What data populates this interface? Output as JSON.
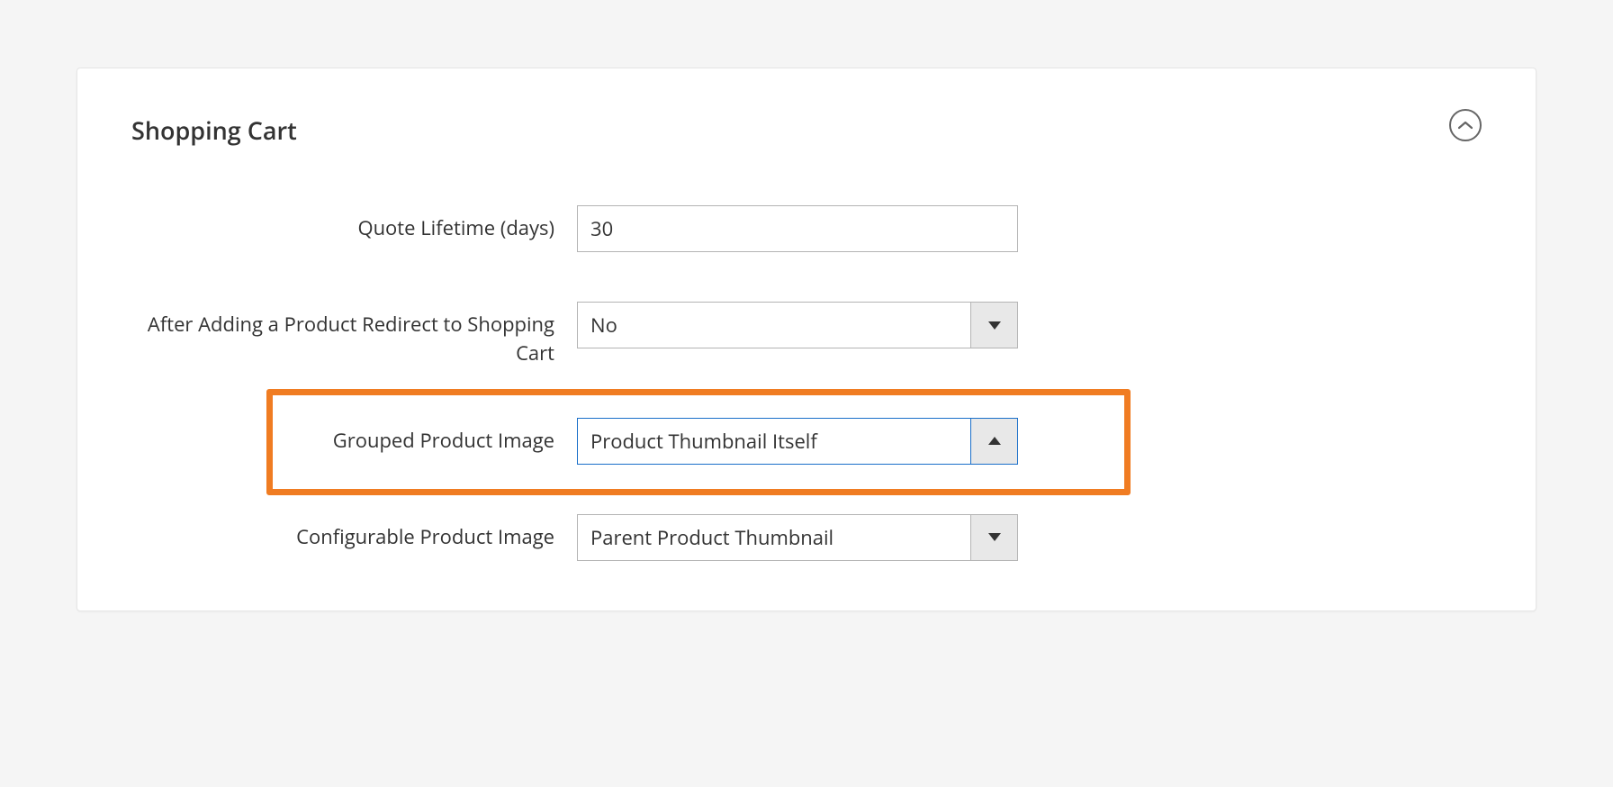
{
  "section": {
    "title": "Shopping Cart"
  },
  "fields": {
    "quote_lifetime": {
      "label": "Quote Lifetime (days)",
      "value": "30"
    },
    "redirect_after_add": {
      "label": "After Adding a Product Redirect to Shopping Cart",
      "value": "No"
    },
    "grouped_product_image": {
      "label": "Grouped Product Image",
      "value": "Product Thumbnail Itself"
    },
    "configurable_product_image": {
      "label": "Configurable Product Image",
      "value": "Parent Product Thumbnail"
    }
  }
}
